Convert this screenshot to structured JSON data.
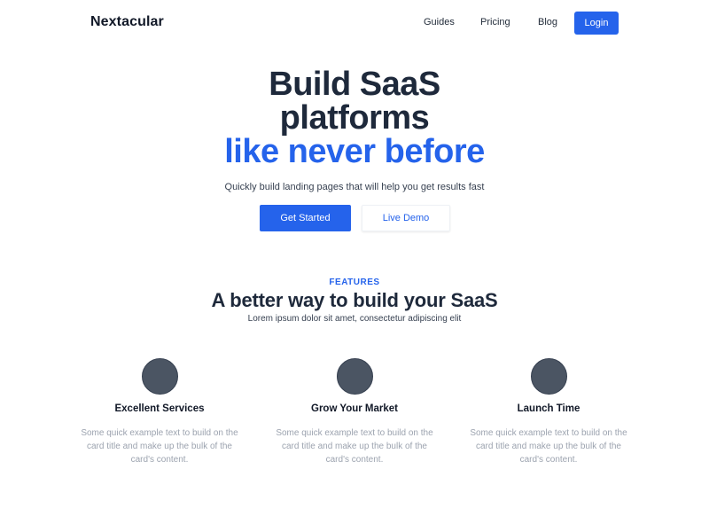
{
  "nav": {
    "brand": "Nextacular",
    "links": [
      {
        "label": "Guides"
      },
      {
        "label": "Pricing"
      },
      {
        "label": "Blog"
      }
    ],
    "login_label": "Login"
  },
  "hero": {
    "title_line1": "Build SaaS",
    "title_line2": "platforms",
    "title_line3": "like never before",
    "subtitle": "Quickly build landing pages that will help you get results fast",
    "primary_button": "Get Started",
    "secondary_button": "Live Demo"
  },
  "features": {
    "eyebrow": "FEATURES",
    "title": "A better way to build your SaaS",
    "subtitle": "Lorem ipsum dolor sit amet, consectetur adipiscing elit",
    "cards": [
      {
        "title": "Excellent Services",
        "text": "Some quick example text to build on the card title and make up the bulk of the card's content."
      },
      {
        "title": "Grow Your Market",
        "text": "Some quick example text to build on the card title and make up the bulk of the card's content."
      },
      {
        "title": "Launch Time",
        "text": "Some quick example text to build on the card title and make up the bulk of the card's content."
      }
    ]
  },
  "colors": {
    "accent": "#2563eb",
    "heading": "#1e293b",
    "muted": "#9ca3af",
    "icon_circle": "#4b5563"
  }
}
